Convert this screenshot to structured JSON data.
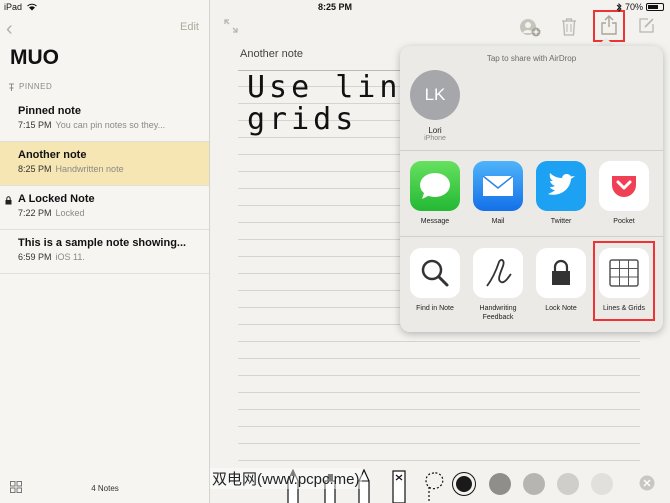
{
  "statusbar": {
    "device": "iPad",
    "time": "8:25 PM",
    "battery": "70%",
    "battery_level": 0.7
  },
  "sidebar": {
    "back_glyph": "‹",
    "edit_label": "Edit",
    "title": "MUO",
    "pinned_label": "PINNED",
    "notes": [
      {
        "title": "Pinned note",
        "time": "7:15 PM",
        "snippet": "You can pin notes so they..."
      },
      {
        "title": "Another note",
        "time": "8:25 PM",
        "snippet": "Handwritten note"
      },
      {
        "title": "A Locked Note",
        "time": "7:22 PM",
        "snippet": "Locked"
      },
      {
        "title": "This is a sample note showing...",
        "time": "6:59 PM",
        "snippet": "iOS 11."
      }
    ],
    "count": "4 Notes"
  },
  "note": {
    "heading": "Another note",
    "handwriting_line1": "Use lin",
    "handwriting_line2": "grids"
  },
  "share": {
    "airdrop_hint": "Tap to share with AirDrop",
    "contact_initials": "LK",
    "contact_name": "Lori",
    "contact_device": "iPhone",
    "apps": [
      {
        "label": "Message",
        "color": "#34c759"
      },
      {
        "label": "Mail",
        "color": "#1d8cf2"
      },
      {
        "label": "Twitter",
        "color": "#1da1f2"
      },
      {
        "label": "Pocket",
        "color": "#ffffff"
      }
    ],
    "actions": [
      {
        "label": "Find in Note"
      },
      {
        "label": "Handwriting Feedback"
      },
      {
        "label": "Lock Note"
      },
      {
        "label": "Lines & Grids"
      }
    ]
  },
  "watermark": "双电网(www.pcpc.me)",
  "colors": {
    "accent_red": "#e33333",
    "selected_note": "#f5e6b4"
  }
}
